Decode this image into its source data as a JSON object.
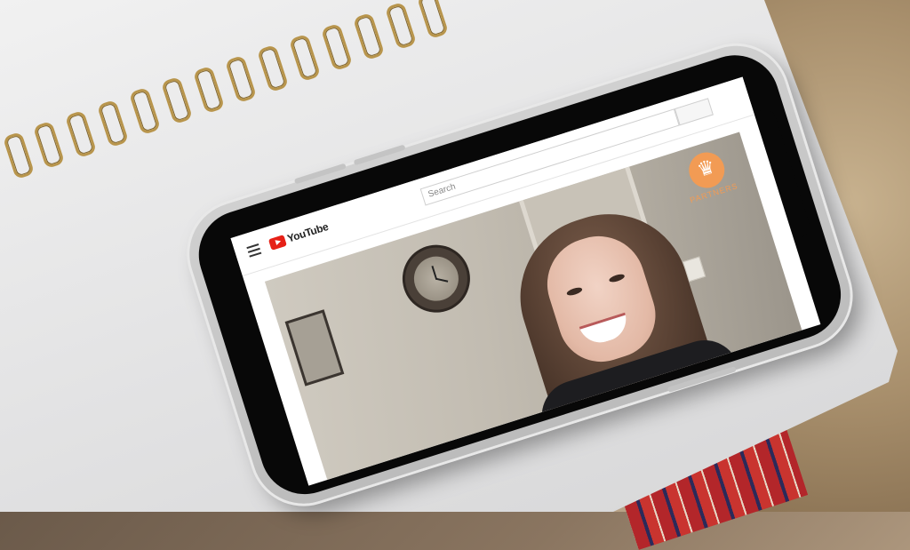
{
  "browser": {
    "app_name": "YouTube",
    "search_placeholder": "Search"
  },
  "video": {
    "overlay_brand": "PARTNERS"
  },
  "icons": {
    "menu": "hamburger-menu-icon",
    "logo": "youtube-logo-icon",
    "overlay": "partners-logo-icon"
  },
  "colors": {
    "youtube_red": "#e62117",
    "overlay_orange": "#f29b54"
  }
}
